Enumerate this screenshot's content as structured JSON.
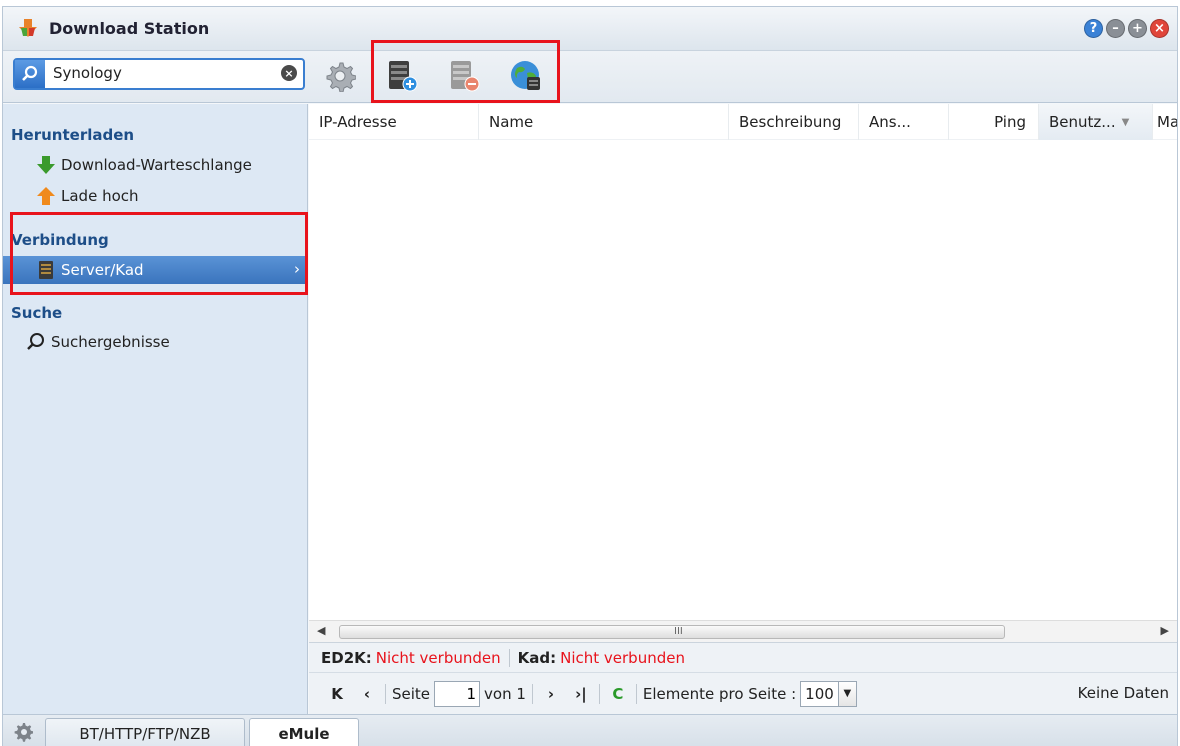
{
  "window": {
    "title": "Download Station",
    "buttons": [
      "help-icon",
      "minimize-icon",
      "maximize-icon",
      "close-icon"
    ]
  },
  "toolbar": {
    "search_value": "Synology",
    "settings": "gear-icon",
    "add_server": "server-add-icon",
    "remove_server": "server-remove-icon",
    "update_servers": "globe-icon"
  },
  "sidebar": {
    "sections": [
      {
        "title": "Herunterladen",
        "items": [
          {
            "label": "Download-Warteschlange",
            "icon": "download-arrow-icon"
          },
          {
            "label": "Lade hoch",
            "icon": "upload-arrow-icon"
          }
        ]
      },
      {
        "title": "Verbindung",
        "items": [
          {
            "label": "Server/Kad",
            "icon": "server-icon",
            "active": true
          }
        ]
      },
      {
        "title": "Suche",
        "items": [
          {
            "label": "Suchergebnisse",
            "icon": "search-icon"
          }
        ]
      }
    ]
  },
  "grid": {
    "columns": [
      "IP-Adresse",
      "Name",
      "Beschreibung",
      "Ans...",
      "Ping",
      "Benutz...",
      "Ma"
    ],
    "rows": []
  },
  "status": {
    "ed2k_label": "ED2K:",
    "ed2k_value": "Nicht verbunden",
    "kad_label": "Kad:",
    "kad_value": "Nicht verbunden"
  },
  "pager": {
    "page_label": "Seite",
    "page_value": "1",
    "of_label": "von 1",
    "per_page_label": "Elemente pro Seite :",
    "per_page_value": "100",
    "no_data": "Keine Daten"
  },
  "tabs": [
    "BT/HTTP/FTP/NZB",
    "eMule"
  ],
  "colors": {
    "accent": "#3a74bd",
    "highlight_border": "#e8131c",
    "error_text": "#e8131c"
  }
}
